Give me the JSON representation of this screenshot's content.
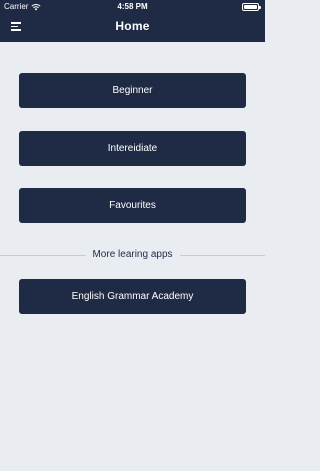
{
  "status_bar": {
    "carrier": "Carrier",
    "time": "4:58 PM"
  },
  "header": {
    "title": "Home"
  },
  "menu": [
    {
      "label": "Beginner"
    },
    {
      "label": "Intereidiate"
    },
    {
      "label": "Favourites"
    }
  ],
  "more_apps": {
    "title": "More learing apps",
    "items": [
      {
        "label": "English Grammar Academy"
      }
    ]
  },
  "colors": {
    "primary": "#1f2a44",
    "background": "#e9edf1",
    "divider": "#c6ccd3"
  },
  "icons": [
    "wifi-icon",
    "battery-icon",
    "menu-icon"
  ]
}
